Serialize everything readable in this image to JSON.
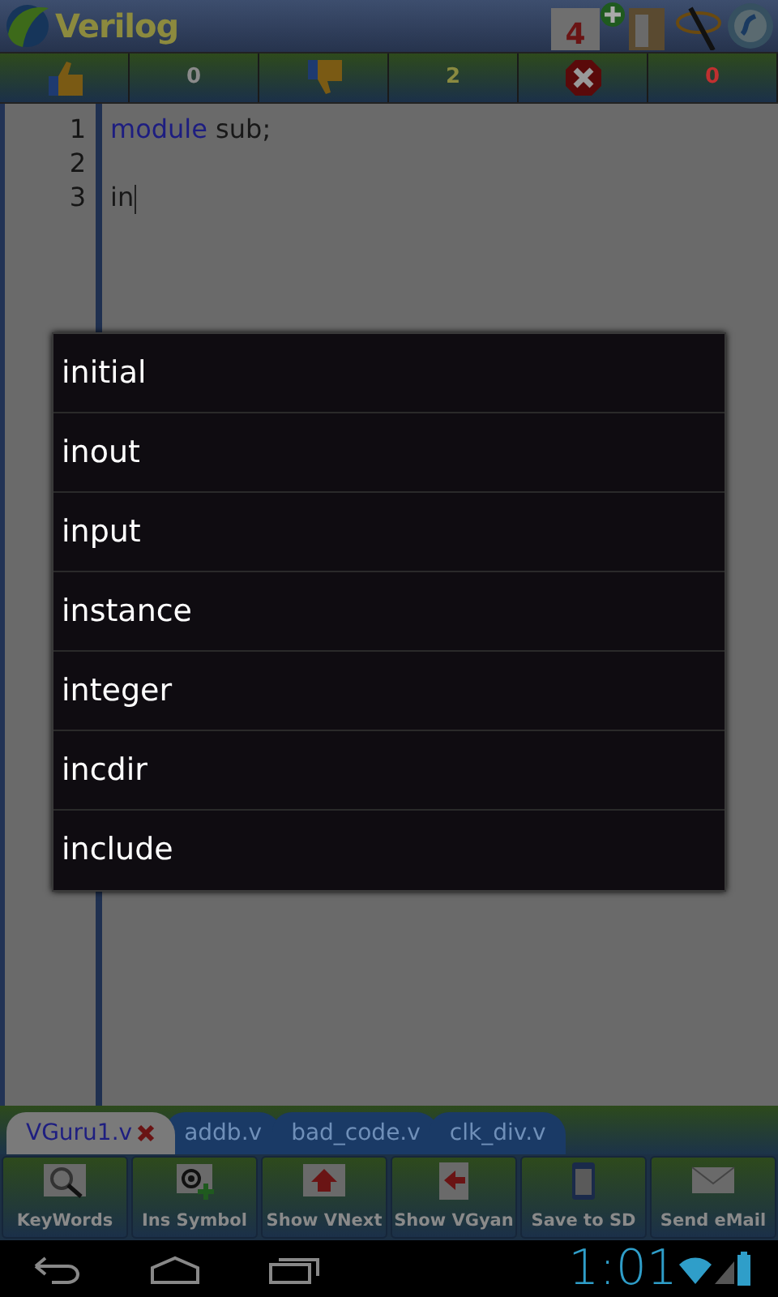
{
  "app_bar": {
    "title": "Verilog",
    "badge_count": "4"
  },
  "score_bar": [
    {
      "kind": "likes",
      "value": "0",
      "color": "#8a8a8a"
    },
    {
      "kind": "dislikes",
      "value": "2",
      "color": "#8a8a40"
    },
    {
      "kind": "errors",
      "value": "0",
      "color": "#c03030"
    }
  ],
  "editor": {
    "lines": [
      {
        "number": "1",
        "tokens": [
          {
            "text": "module",
            "kind": "keyword"
          },
          {
            "text": " sub;",
            "kind": "plain"
          }
        ]
      },
      {
        "number": "2"
      },
      {
        "number": "3",
        "tokens": [
          {
            "text": "in",
            "kind": "plain"
          }
        ],
        "cursor": true
      }
    ]
  },
  "suggestions": [
    {
      "label": "initial"
    },
    {
      "label": "inout"
    },
    {
      "label": "input"
    },
    {
      "label": "instance"
    },
    {
      "label": "integer"
    },
    {
      "label": "incdir"
    },
    {
      "label": "include"
    }
  ],
  "file_tabs": [
    {
      "label": "VGuru1.v",
      "selected": true
    },
    {
      "label": "addb.v",
      "selected": false
    },
    {
      "label": "bad_code.v",
      "selected": false
    },
    {
      "label": "clk_div.v",
      "selected": false
    }
  ],
  "actions": [
    {
      "kind": "keywords",
      "label": "KeyWords"
    },
    {
      "kind": "symbol",
      "label": "Ins Symbol"
    },
    {
      "kind": "next",
      "label": "Show VNext"
    },
    {
      "kind": "gyan",
      "label": "Show VGyan"
    },
    {
      "kind": "save",
      "label": "Save to SD"
    },
    {
      "kind": "email",
      "label": "Send eMail"
    }
  ],
  "status_bar": {
    "time": "1:01"
  }
}
